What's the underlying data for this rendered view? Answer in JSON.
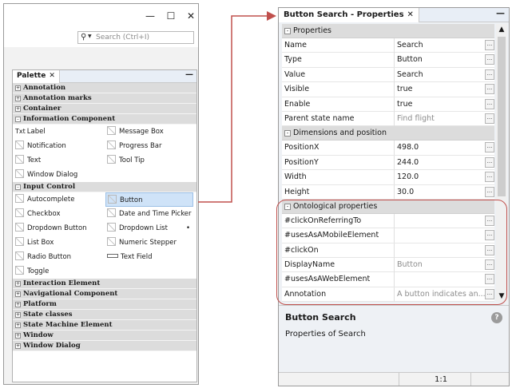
{
  "window": {
    "minimize_glyph": "—",
    "maximize_glyph": "☐",
    "close_glyph": "✕",
    "search_placeholder": "Search (Ctrl+I)"
  },
  "palette": {
    "tab_label": "Palette",
    "tab_close": "✕",
    "minimize": "—",
    "categories_top": [
      {
        "name": "Annotation",
        "icon": "+"
      },
      {
        "name": "Annotation marks",
        "icon": "+"
      },
      {
        "name": "Container",
        "icon": "+"
      },
      {
        "name": "Information Component",
        "icon": "-"
      }
    ],
    "info_items": [
      {
        "left": "Label",
        "left_icon": "Txt",
        "right": "Message Box"
      },
      {
        "left": "Notification",
        "right": "Progress Bar"
      },
      {
        "left": "Text",
        "right": "Tool Tip"
      },
      {
        "left": "Window Dialog",
        "right": ""
      }
    ],
    "input_category": {
      "name": "Input Control",
      "icon": "-"
    },
    "input_items": [
      {
        "left": "Autocomplete",
        "right": "Button"
      },
      {
        "left": "Checkbox",
        "right": "Date and Time Picker"
      },
      {
        "left": "Dropdown Button",
        "right": "Dropdown List",
        "right_extra": "•"
      },
      {
        "left": "List Box",
        "right": "Numeric Stepper"
      },
      {
        "left": "Radio Button",
        "right": "Text Field"
      },
      {
        "left": "Toggle",
        "right": ""
      }
    ],
    "selected_item": "Button",
    "categories_bottom": [
      {
        "name": "Interaction Element",
        "icon": "+"
      },
      {
        "name": "Navigational Component",
        "icon": "+"
      },
      {
        "name": "Platform",
        "icon": "+"
      },
      {
        "name": "State classes",
        "icon": "+"
      },
      {
        "name": "State Machine Element",
        "icon": "+"
      },
      {
        "name": "Window",
        "icon": "+"
      },
      {
        "name": "Window Dialog",
        "icon": "+"
      }
    ]
  },
  "properties": {
    "tab_label": "Button Search - Properties",
    "tab_close": "✕",
    "minimize": "—",
    "sections": [
      {
        "title": "Properties",
        "icon": "-",
        "rows": [
          {
            "name": "Name",
            "value": "Search"
          },
          {
            "name": "Type",
            "value": "Button"
          },
          {
            "name": "Value",
            "value": "Search"
          },
          {
            "name": "Visible",
            "value": "true"
          },
          {
            "name": "Enable",
            "value": "true"
          },
          {
            "name": "Parent state name",
            "value": "Find flight",
            "muted": true
          }
        ]
      },
      {
        "title": "Dimensions and position",
        "icon": "-",
        "rows": [
          {
            "name": "PositionX",
            "value": "498.0"
          },
          {
            "name": "PositionY",
            "value": "244.0"
          },
          {
            "name": "Width",
            "value": "120.0"
          },
          {
            "name": "Height",
            "value": "30.0"
          }
        ]
      },
      {
        "title": "Ontological properties",
        "icon": "-",
        "rows": [
          {
            "name": "#clickOnReferringTo",
            "value": ""
          },
          {
            "name": "#usesAsAMobileElement",
            "value": ""
          },
          {
            "name": "#clickOn",
            "value": ""
          },
          {
            "name": "DisplayName",
            "value": "Button",
            "muted": true
          },
          {
            "name": "#usesAsAWebElement",
            "value": ""
          },
          {
            "name": "Annotation",
            "value": "A button indicates an...",
            "muted": true
          }
        ]
      }
    ],
    "ellipsis": "...",
    "description_title": "Button Search",
    "description_text": "Properties of Search",
    "help_glyph": "?",
    "zoom": "1:1",
    "scroll_up": "▲",
    "scroll_down": "▼"
  },
  "colors": {
    "connector": "#c0504d",
    "highlight": "#c0504d",
    "selected_bg": "#cfe3f8"
  }
}
